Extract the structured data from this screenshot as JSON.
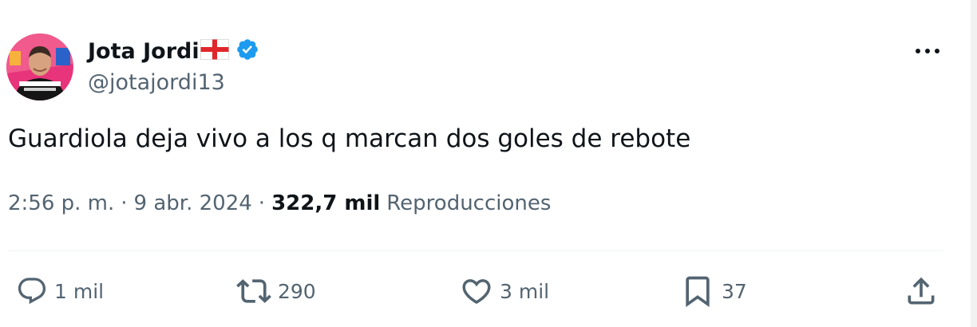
{
  "author": {
    "display_name": "Jota Jordi",
    "handle": "@jotajordi13"
  },
  "icons": {
    "flag": "england-flag-icon",
    "verified": "verified-badge-icon",
    "more": "more-options-icon",
    "reply": "reply-icon",
    "retweet": "retweet-icon",
    "like": "heart-icon",
    "bookmark": "bookmark-icon",
    "share": "share-icon"
  },
  "tweet": {
    "text": "Guardiola deja vivo a los q marcan dos goles de rebote",
    "time": "2:56 p. m.",
    "date": "9 abr. 2024",
    "separator": "·",
    "views_count": "322,7 mil",
    "views_label": "Reproducciones"
  },
  "actions": {
    "replies": "1 mil",
    "retweets": "290",
    "likes": "3 mil",
    "bookmarks": "37"
  },
  "colors": {
    "text_primary": "#0f1419",
    "text_secondary": "#536471",
    "verified_blue": "#1d9bf0",
    "divider": "#eff3f4"
  }
}
